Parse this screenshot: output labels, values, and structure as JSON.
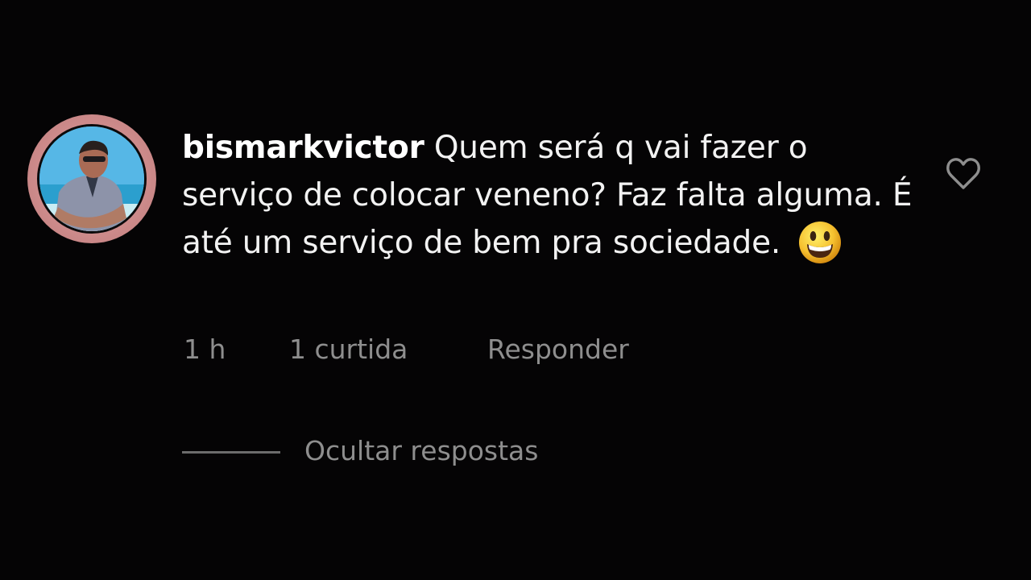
{
  "comment": {
    "username": "bismarkvictor",
    "text": "Quem será q vai fazer o serviço de colocar veneno? Faz falta alguma. É até um serviço de bem pra sociedade.",
    "emoji": "grinning-face-icon",
    "time": "1 h",
    "likes": "1 curtida",
    "reply_label": "Responder",
    "like_icon": "heart-outline-icon"
  },
  "replies": {
    "toggle_label": "Ocultar respostas"
  },
  "colors": {
    "background": "#050405",
    "text": "#f2f2f2",
    "muted": "#8e8e8e",
    "story_ring": "#e7a4a4"
  }
}
